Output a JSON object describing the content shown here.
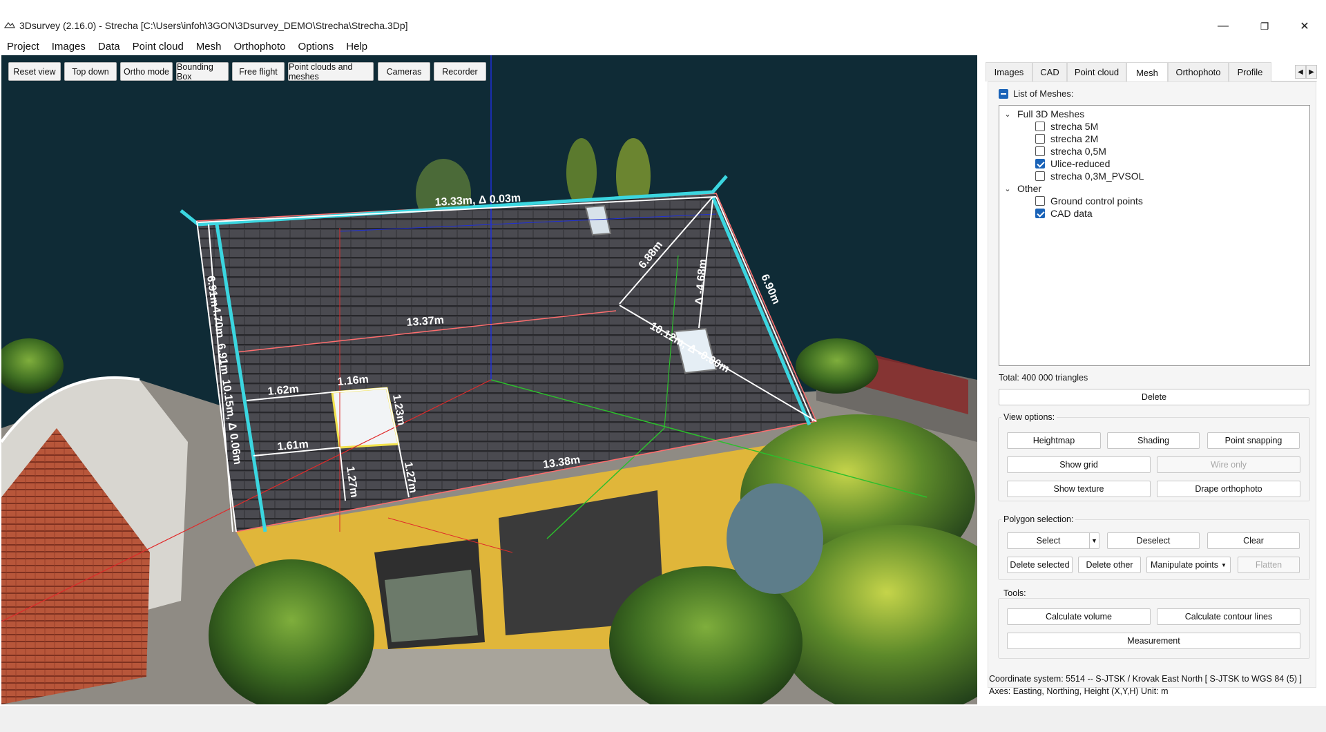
{
  "window": {
    "title": "3Dsurvey (2.16.0) - Strecha [C:\\Users\\infoh\\3GON\\3Dsurvey_DEMO\\Strecha\\Strecha.3Dp]",
    "minimize": "—",
    "restore": "❐",
    "close": "✕"
  },
  "menu": [
    "Project",
    "Images",
    "Data",
    "Point cloud",
    "Mesh",
    "Orthophoto",
    "Options",
    "Help"
  ],
  "toolbar": [
    "Reset view",
    "Top down",
    "Ortho mode",
    "Bounding Box",
    "Free flight",
    "Point clouds and meshes",
    "Cameras",
    "Recorder"
  ],
  "measurements": {
    "ridge": "13.33m, Δ 0.03m",
    "middle": "13.37m",
    "eave": "13.38m",
    "diag": "6.88m",
    "vert": "Δ -4.68m",
    "right_edge": "6.90m",
    "diag2": "10.12m, Δ -0.00m",
    "left_edge_a": "6.91m",
    "left_edge_b": "4.70m",
    "left_edge_c": "6.91m",
    "left_edge_d": "10.15m, Δ 0.06m",
    "win_left_top": "1.62m",
    "win_top": "1.16m",
    "win_right": "1.23m",
    "win_left_bottom": "1.61m",
    "win_down_a": "1.27m",
    "win_down_b": "1.27m"
  },
  "tabs": [
    "Images",
    "CAD",
    "Point cloud",
    "Mesh",
    "Orthophoto",
    "Profile"
  ],
  "tab_scroll": {
    "left": "◀",
    "right": "▶"
  },
  "active_tab": "Mesh",
  "mesh_panel": {
    "list_label": "List of Meshes:",
    "groups": [
      {
        "name": "Full 3D Meshes",
        "items": [
          {
            "label": "strecha 5M",
            "checked": false
          },
          {
            "label": "strecha 2M",
            "checked": false
          },
          {
            "label": "strecha 0,5M",
            "checked": false
          },
          {
            "label": "Ulice-reduced",
            "checked": true
          },
          {
            "label": "strecha 0,3M_PVSOL",
            "checked": false
          }
        ]
      },
      {
        "name": "Other",
        "items": [
          {
            "label": "Ground control points",
            "checked": false
          },
          {
            "label": "CAD data",
            "checked": true
          }
        ]
      }
    ],
    "total": "Total: 400 000 triangles",
    "delete": "Delete",
    "view_options_label": "View options:",
    "view_options": {
      "heightmap": "Heightmap",
      "shading": "Shading",
      "point_snapping": "Point snapping",
      "show_grid": "Show grid",
      "wire_only": "Wire only",
      "show_texture": "Show texture",
      "drape_orthophoto": "Drape orthophoto"
    },
    "polygon_label": "Polygon selection:",
    "polygon": {
      "select": "Select",
      "deselect": "Deselect",
      "clear": "Clear",
      "delete_selected": "Delete selected",
      "delete_other": "Delete other",
      "manipulate_points": "Manipulate points",
      "flatten": "Flatten"
    },
    "tools_label": "Tools:",
    "tools": {
      "calc_volume": "Calculate volume",
      "calc_contour": "Calculate contour lines",
      "measurement": "Measurement"
    }
  },
  "coordinates": {
    "line1": "Coordinate system: 5514 -- S-JTSK / Krovak East North [ S-JTSK to WGS 84 (5) ]",
    "line2": "Axes: Easting, Northing, Height (X,Y,H) Unit: m"
  }
}
